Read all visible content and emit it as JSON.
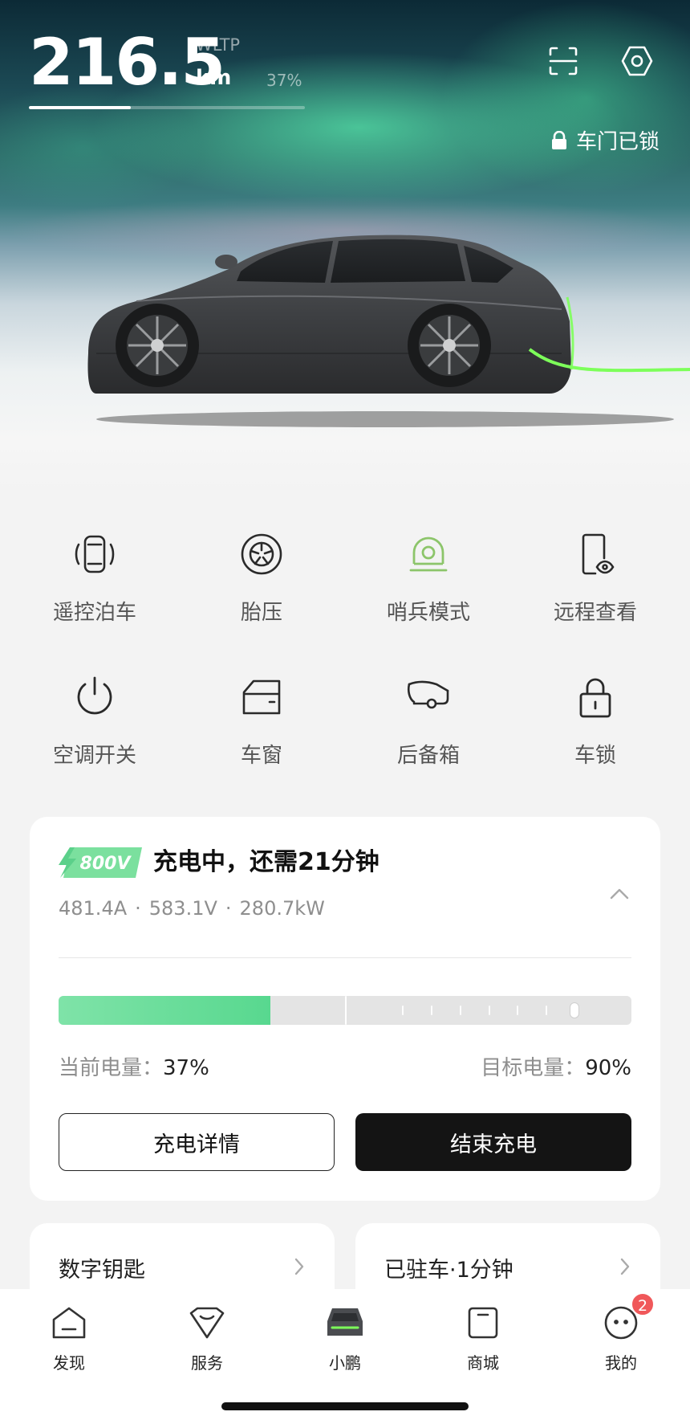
{
  "hero": {
    "range_value": "216.5",
    "range_standard": "WLTP",
    "range_unit": "km",
    "battery_percent_label": "37%",
    "battery_fraction": 0.37,
    "lock_status": "车门已锁",
    "icons": {
      "scan": "scan-icon",
      "settings": "settings-hexagon-icon",
      "lock": "lock-icon"
    }
  },
  "actions": [
    {
      "label": "遥控泊车",
      "icon": "remote-parking-icon"
    },
    {
      "label": "胎压",
      "icon": "tire-pressure-icon"
    },
    {
      "label": "哨兵模式",
      "icon": "sentry-mode-icon"
    },
    {
      "label": "远程查看",
      "icon": "remote-view-icon"
    },
    {
      "label": "空调开关",
      "icon": "power-icon"
    },
    {
      "label": "车窗",
      "icon": "window-icon"
    },
    {
      "label": "后备箱",
      "icon": "trunk-icon"
    },
    {
      "label": "车锁",
      "icon": "padlock-icon"
    }
  ],
  "charging": {
    "badge": "800V",
    "title": "充电中，还需21分钟",
    "current": "481.4A",
    "voltage": "583.1V",
    "power": "280.7kW",
    "current_level_label": "当前电量：",
    "current_level_value": "37%",
    "current_fraction": 0.37,
    "target_level_label": "目标电量：",
    "target_level_value": "90%",
    "target_fraction": 0.9,
    "details_button": "充电详情",
    "stop_button": "结束充电"
  },
  "mini_cards": {
    "digital_key": "数字钥匙",
    "parked": "已驻车·1分钟"
  },
  "nav": {
    "items": [
      {
        "label": "发现",
        "icon": "discover-icon"
      },
      {
        "label": "服务",
        "icon": "service-icon"
      },
      {
        "label": "小鹏",
        "icon": "car-icon"
      },
      {
        "label": "商城",
        "icon": "store-icon"
      },
      {
        "label": "我的",
        "icon": "profile-icon"
      }
    ],
    "badge_count": "2"
  },
  "colors": {
    "accent_green": "#58d88f",
    "sentry_green": "#8cc56a",
    "dark_button": "#141414",
    "badge_red": "#f0585a"
  }
}
